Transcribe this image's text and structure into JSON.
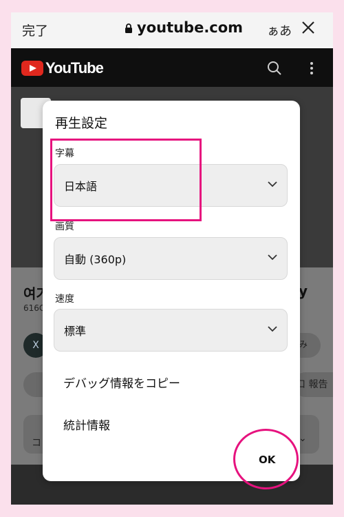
{
  "browser": {
    "done_label": "完了",
    "url": "youtube.com",
    "text_size_label": "ぁあ"
  },
  "youtube": {
    "logo_text": "YouTube",
    "title_fragment_left": "여기",
    "title_fragment_right": "y",
    "views_fragment": "616C",
    "avatar_text": "X",
    "chip_fragment": "み",
    "report_fragment": "口 報告",
    "comment_fragment": "コ"
  },
  "dialog": {
    "title": "再生設定",
    "subtitles": {
      "label": "字幕",
      "value": "日本語"
    },
    "quality": {
      "label": "画質",
      "value": "自動 (360p)"
    },
    "speed": {
      "label": "速度",
      "value": "標準"
    },
    "copy_debug_label": "デバッグ情報をコピー",
    "stats_label": "統計情報",
    "ok_label": "OK"
  },
  "colors": {
    "highlight": "#e6127e",
    "background": "#fbe0ec",
    "youtube_red": "#e0281e"
  }
}
